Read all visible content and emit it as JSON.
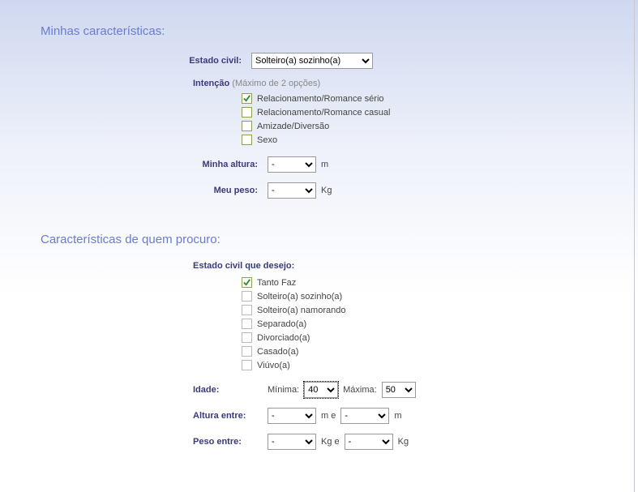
{
  "section1": {
    "title": "Minhas características:",
    "estado_civil": {
      "label": "Estado civil:",
      "value": "Solteiro(a) sozinho(a)"
    },
    "intencao": {
      "label": "Intenção",
      "hint": "(Máximo de 2 opções)",
      "options": [
        {
          "label": "Relacionamento/Romance sério",
          "checked": true
        },
        {
          "label": "Relacionamento/Romance casual",
          "checked": false
        },
        {
          "label": "Amizade/Diversão",
          "checked": false
        },
        {
          "label": "Sexo",
          "checked": false
        }
      ]
    },
    "altura": {
      "label": "Minha altura:",
      "value": "-",
      "unit": "m"
    },
    "peso": {
      "label": "Meu peso:",
      "value": "-",
      "unit": "Kg"
    }
  },
  "section2": {
    "title": "Características de quem procuro:",
    "estado_civil_desejo": {
      "label": "Estado civil que desejo:",
      "options": [
        {
          "label": "Tanto Faz",
          "checked": true
        },
        {
          "label": "Solteiro(a) sozinho(a)",
          "checked": false
        },
        {
          "label": "Solteiro(a) namorando",
          "checked": false
        },
        {
          "label": "Separado(a)",
          "checked": false
        },
        {
          "label": "Divorciado(a)",
          "checked": false
        },
        {
          "label": "Casado(a)",
          "checked": false
        },
        {
          "label": "Viúvo(a)",
          "checked": false
        }
      ]
    },
    "idade": {
      "label": "Idade:",
      "min_label": "Mínima:",
      "min_value": "40",
      "max_label": "Máxima:",
      "max_value": "50"
    },
    "altura_entre": {
      "label": "Altura entre:",
      "from": "-",
      "conj": "m e",
      "to": "-",
      "unit": "m"
    },
    "peso_entre": {
      "label": "Peso entre:",
      "from": "-",
      "conj": "Kg e",
      "to": "-",
      "unit": "Kg"
    }
  }
}
